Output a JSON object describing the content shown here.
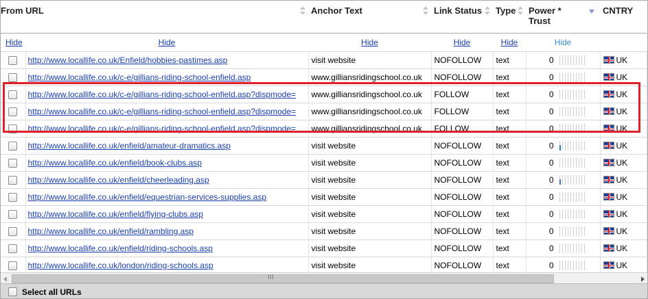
{
  "columns": {
    "from_url": "From URL",
    "anchor_text": "Anchor Text",
    "link_status": "Link Status",
    "type": "Type",
    "power_trust": "Power * Trust",
    "country": "CNTRY"
  },
  "hide_label": "Hide",
  "rows": [
    {
      "url": "http://www.locallife.co.uk/Enfield/hobbies-pastimes.asp",
      "anchor": "visit website",
      "status": "NOFOLLOW",
      "type": "text",
      "power": "0",
      "bar": 0,
      "country": "UK"
    },
    {
      "url": "http://www.locallife.co.uk/c-e/gillians-riding-school-enfield.asp",
      "anchor": "www.gilliansridingschool.co.uk",
      "status": "NOFOLLOW",
      "type": "text",
      "power": "0",
      "bar": 0,
      "country": "UK"
    },
    {
      "url": "http://www.locallife.co.uk/c-e/gillians-riding-school-enfield.asp?dispmode=",
      "anchor": "www.gilliansridingschool.co.uk",
      "status": "FOLLOW",
      "type": "text",
      "power": "0",
      "bar": 0,
      "country": "UK"
    },
    {
      "url": "http://www.locallife.co.uk/c-e/gillians-riding-school-enfield.asp?dispmode=",
      "anchor": "www.gilliansridingschool.co.uk",
      "status": "FOLLOW",
      "type": "text",
      "power": "0",
      "bar": 0,
      "country": "UK"
    },
    {
      "url": "http://www.locallife.co.uk/c-e/gillians-riding-school-enfield.asp?dispmode=",
      "anchor": "www.gilliansridingschool.co.uk",
      "status": "FOLLOW",
      "type": "text",
      "power": "0",
      "bar": 0,
      "country": "UK"
    },
    {
      "url": "http://www.locallife.co.uk/enfield/amateur-dramatics.asp",
      "anchor": "visit website",
      "status": "NOFOLLOW",
      "type": "text",
      "power": "0",
      "bar": 0.6,
      "country": "UK"
    },
    {
      "url": "http://www.locallife.co.uk/enfield/book-clubs.asp",
      "anchor": "visit website",
      "status": "NOFOLLOW",
      "type": "text",
      "power": "0",
      "bar": 0,
      "country": "UK"
    },
    {
      "url": "http://www.locallife.co.uk/enfield/cheerleading.asp",
      "anchor": "visit website",
      "status": "NOFOLLOW",
      "type": "text",
      "power": "0",
      "bar": 0.6,
      "country": "UK"
    },
    {
      "url": "http://www.locallife.co.uk/enfield/equestrian-services-supplies.asp",
      "anchor": "visit website",
      "status": "NOFOLLOW",
      "type": "text",
      "power": "0",
      "bar": 0,
      "country": "UK"
    },
    {
      "url": "http://www.locallife.co.uk/enfield/flying-clubs.asp",
      "anchor": "visit website",
      "status": "NOFOLLOW",
      "type": "text",
      "power": "0",
      "bar": 0,
      "country": "UK"
    },
    {
      "url": "http://www.locallife.co.uk/enfield/rambling.asp",
      "anchor": "visit website",
      "status": "NOFOLLOW",
      "type": "text",
      "power": "0",
      "bar": 0,
      "country": "UK"
    },
    {
      "url": "http://www.locallife.co.uk/enfield/riding-schools.asp",
      "anchor": "visit website",
      "status": "NOFOLLOW",
      "type": "text",
      "power": "0",
      "bar": 0,
      "country": "UK"
    },
    {
      "url": "http://www.locallife.co.uk/london/riding-schools.asp",
      "anchor": "visit website",
      "status": "NOFOLLOW",
      "type": "text",
      "power": "0",
      "bar": 0,
      "country": "UK"
    }
  ],
  "footer": {
    "select_all": "Select all URLs"
  },
  "colors": {
    "link": "#1a3fb0",
    "highlight": "#e2202b",
    "bar": "#3b76c8"
  }
}
